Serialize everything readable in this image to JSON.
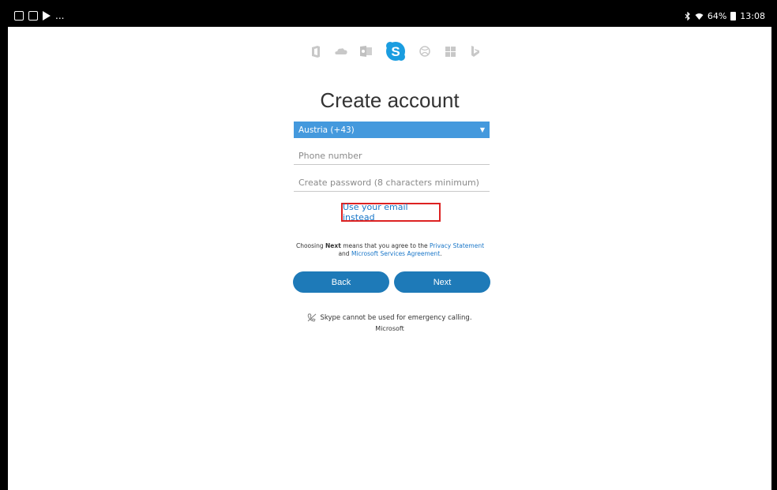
{
  "statusbar": {
    "left_dots": "...",
    "battery": "64%",
    "time": "13:08",
    "left_icons": [
      "gallery-icon",
      "clipboard-icon",
      "play-store-icon"
    ],
    "right_icons": [
      "bluetooth-icon",
      "wifi-icon",
      "battery-icon"
    ]
  },
  "app_icons": [
    "office-icon",
    "onedrive-icon",
    "outlook-icon",
    "skype-icon",
    "xbox-icon",
    "windows-icon",
    "bing-icon"
  ],
  "page": {
    "title": "Create account"
  },
  "form": {
    "country_value": "Austria (+43)",
    "phone_placeholder": "Phone number",
    "password_placeholder": "Create password (8 characters minimum)",
    "email_link": "Use your email instead"
  },
  "terms": {
    "prefix": "Choosing ",
    "bold": "Next",
    "middle": " means that you agree to the ",
    "privacy_link": "Privacy Statement",
    "and": "and ",
    "services_link": "Microsoft Services Agreement",
    "suffix": "."
  },
  "buttons": {
    "back": "Back",
    "next": "Next"
  },
  "footer": {
    "notice": "Skype cannot be used for emergency calling.",
    "brand": "Microsoft"
  },
  "colors": {
    "accent_blue": "#1e7ab8",
    "select_blue": "#4499dd",
    "link_blue": "#1976c8",
    "highlight_red": "#dd2222"
  }
}
